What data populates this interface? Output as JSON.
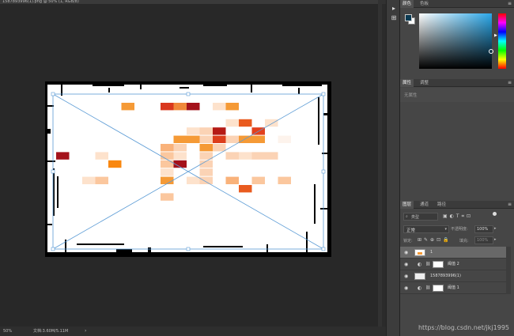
{
  "document": {
    "tab_title": "1587893996(1).png @ 50% (1, RGB/8)",
    "zoom": "50%",
    "doc_info": "文档:3.60M/5.11M"
  },
  "panels": {
    "color": {
      "tabs": [
        "颜色",
        "色板"
      ],
      "foreground": "#0b3a52",
      "background": "#ffffff"
    },
    "properties": {
      "tabs": [
        "属性",
        "调整"
      ],
      "empty_text": "无属性"
    },
    "layers": {
      "tabs": [
        "图层",
        "通道",
        "路径"
      ],
      "filter_label": "类型",
      "blend_mode": "正常",
      "opacity_label": "不透明度:",
      "opacity_value": "100%",
      "lock_label": "锁定:",
      "fill_label": "填充:",
      "fill_value": "100%",
      "items": [
        {
          "name": "1",
          "selected": true,
          "type": "image"
        },
        {
          "name": "阈值 2",
          "selected": false,
          "type": "adjustment"
        },
        {
          "name": "1587893996(1)",
          "selected": false,
          "type": "image"
        },
        {
          "name": "阈值 1",
          "selected": false,
          "type": "adjustment"
        }
      ]
    }
  },
  "heatmap": {
    "cells": [
      [
        5,
        0,
        "#f59a36"
      ],
      [
        8,
        0,
        "#d9381e"
      ],
      [
        9,
        0,
        "#f0883a"
      ],
      [
        10,
        0,
        "#a4121b"
      ],
      [
        12,
        0,
        "#fde2cc"
      ],
      [
        13,
        0,
        "#f59a36"
      ],
      [
        13,
        2,
        "#fde2cc"
      ],
      [
        14,
        2,
        "#e95b1f"
      ],
      [
        16,
        2,
        "#fde2cc"
      ],
      [
        10,
        3,
        "#fde2cc"
      ],
      [
        11,
        3,
        "#fbd3b5"
      ],
      [
        12,
        3,
        "#b51a15"
      ],
      [
        15,
        3,
        "#e2401d"
      ],
      [
        9,
        4,
        "#f59a36"
      ],
      [
        10,
        4,
        "#f59a36"
      ],
      [
        11,
        4,
        "#fbd3b5"
      ],
      [
        12,
        4,
        "#dc3e1b"
      ],
      [
        13,
        4,
        "#fbd3b5"
      ],
      [
        14,
        4,
        "#f59a36"
      ],
      [
        15,
        4,
        "#f59a36"
      ],
      [
        17,
        4,
        "#fdf3ec"
      ],
      [
        8,
        5,
        "#f9b27a"
      ],
      [
        9,
        5,
        "#fbd3b5"
      ],
      [
        11,
        5,
        "#f59a36"
      ],
      [
        12,
        5,
        "#fbd3b5"
      ],
      [
        0,
        6,
        "#a4121b"
      ],
      [
        3,
        6,
        "#fde2cc"
      ],
      [
        8,
        6,
        "#fbc79e"
      ],
      [
        9,
        6,
        "#fde2cc"
      ],
      [
        11,
        6,
        "#fbd3b5"
      ],
      [
        13,
        6,
        "#fbd3b5"
      ],
      [
        14,
        6,
        "#fde2cc"
      ],
      [
        15,
        6,
        "#fbd3b5"
      ],
      [
        16,
        6,
        "#fbd3b5"
      ],
      [
        4,
        7,
        "#f9870f"
      ],
      [
        8,
        7,
        "#fbc79e"
      ],
      [
        9,
        7,
        "#a4121b"
      ],
      [
        11,
        7,
        "#fbd3b5"
      ],
      [
        8,
        8,
        "#fde2cc"
      ],
      [
        11,
        8,
        "#fbd3b5"
      ],
      [
        2,
        9,
        "#fde2cc"
      ],
      [
        3,
        9,
        "#fbc79e"
      ],
      [
        8,
        9,
        "#f59a36"
      ],
      [
        10,
        9,
        "#fde2cc"
      ],
      [
        11,
        9,
        "#fbd3b5"
      ],
      [
        13,
        9,
        "#f9b27a"
      ],
      [
        15,
        9,
        "#fbc79e"
      ],
      [
        17,
        9,
        "#fbc79e"
      ],
      [
        14,
        10,
        "#e95b1f"
      ],
      [
        8,
        11,
        "#fbc79e"
      ]
    ]
  },
  "watermark": "https://blog.csdn.net/jkj1995"
}
